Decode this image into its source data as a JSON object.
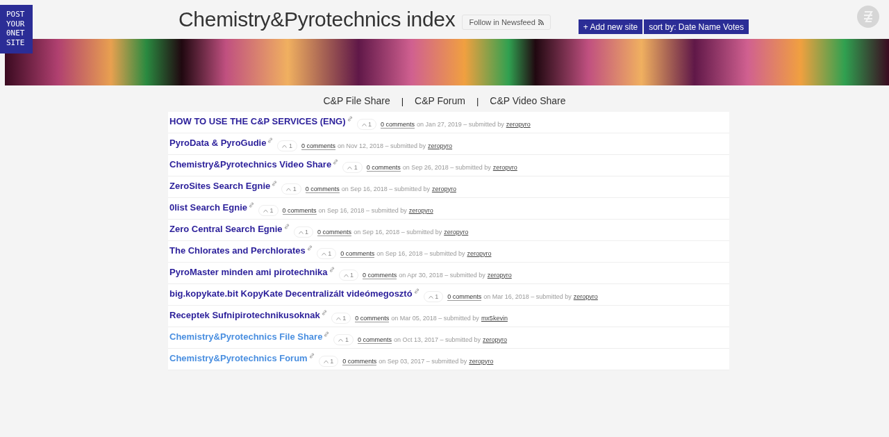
{
  "logo": {
    "lines": [
      "POST",
      "YOUR",
      "0NET",
      "SITE"
    ]
  },
  "header": {
    "title": "Chemistry&Pyrotechnics index",
    "follow_button": "Follow in Newsfeed",
    "add_button": "+ Add new site",
    "sort_button": "sort by: Date Name Votes"
  },
  "nav": [
    {
      "kind": "link",
      "text": "C&P File Share"
    },
    {
      "kind": "separator",
      "text": "|"
    },
    {
      "kind": "link",
      "text": "C&P Forum"
    },
    {
      "kind": "separator",
      "text": "|"
    },
    {
      "kind": "link",
      "text": "C&P Video Share"
    }
  ],
  "sites": [
    {
      "title": "HOW TO USE THE C&P SERVICES (ENG)",
      "visited": false,
      "votes": "1",
      "comments": "0 comments",
      "date": "on Jan 27, 2019 – submitted by",
      "user": "zeropyro"
    },
    {
      "title": "PyroData & PyroGudie",
      "visited": false,
      "votes": "1",
      "comments": "0 comments",
      "date": "on Nov 12, 2018 – submitted by",
      "user": "zeropyro"
    },
    {
      "title": "Chemistry&Pyrotechnics Video Share",
      "visited": false,
      "votes": "1",
      "comments": "0 comments",
      "date": "on Sep 26, 2018 – submitted by",
      "user": "zeropyro"
    },
    {
      "title": "ZeroSites Search Egnie",
      "visited": false,
      "votes": "1",
      "comments": "0 comments",
      "date": "on Sep 16, 2018 – submitted by",
      "user": "zeropyro"
    },
    {
      "title": "0list Search Egnie",
      "visited": false,
      "votes": "1",
      "comments": "0 comments",
      "date": "on Sep 16, 2018 – submitted by",
      "user": "zeropyro"
    },
    {
      "title": "Zero Central Search Egnie",
      "visited": false,
      "votes": "1",
      "comments": "0 comments",
      "date": "on Sep 16, 2018 – submitted by",
      "user": "zeropyro"
    },
    {
      "title": "The Chlorates and Perchlorates",
      "visited": false,
      "votes": "1",
      "comments": "0 comments",
      "date": "on Sep 16, 2018 – submitted by",
      "user": "zeropyro"
    },
    {
      "title": "PyroMaster minden ami pirotechnika",
      "visited": false,
      "votes": "1",
      "comments": "0 comments",
      "date": "on Apr 30, 2018 – submitted by",
      "user": "zeropyro"
    },
    {
      "title": "big.kopykate.bit KopyKate Decentralizált videómegosztó",
      "visited": false,
      "votes": "1",
      "comments": "0 comments",
      "date": "on Mar 16, 2018 – submitted by",
      "user": "zeropyro"
    },
    {
      "title": "Receptek Sufnipirotechnikusoknak",
      "visited": false,
      "votes": "1",
      "comments": "0 comments",
      "date": "on Mar 05, 2018 – submitted by",
      "user": "mx5kevin"
    },
    {
      "title": "Chemistry&Pyrotechnics File Share",
      "visited": true,
      "votes": "1",
      "comments": "0 comments",
      "date": "on Oct 13, 2017 – submitted by",
      "user": "zeropyro"
    },
    {
      "title": "Chemistry&Pyrotechnics Forum",
      "visited": true,
      "votes": "1",
      "comments": "0 comments",
      "date": "on Sep 03, 2017 – submitted by",
      "user": "zeropyro"
    }
  ]
}
